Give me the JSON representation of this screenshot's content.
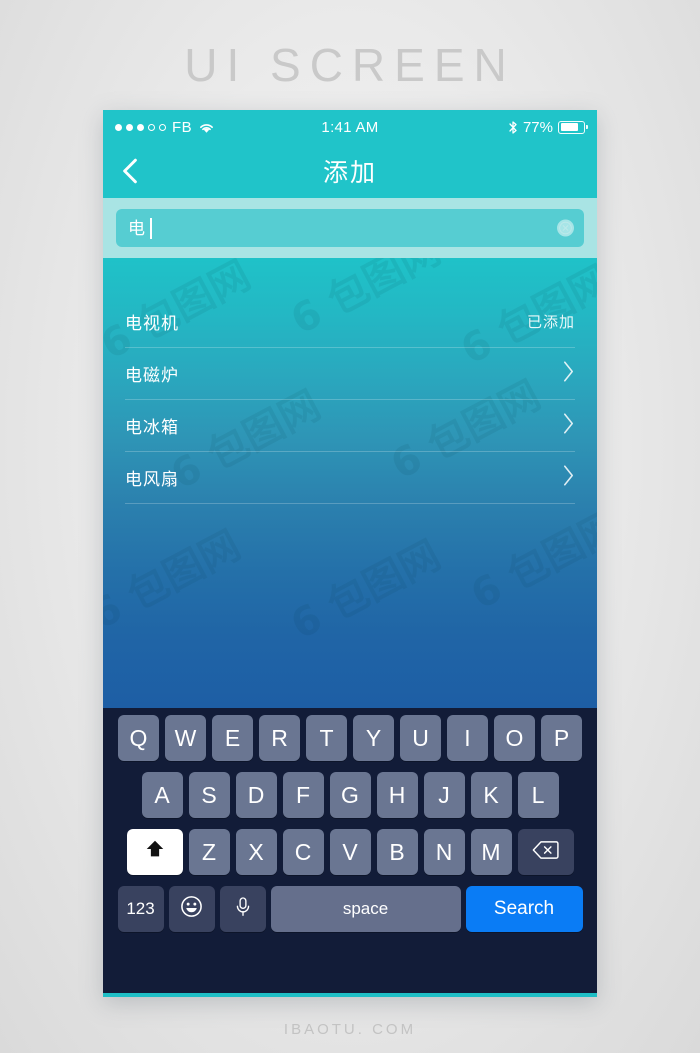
{
  "page": {
    "title": "UI SCREEN",
    "footer": "IBAOTU. COM",
    "watermark_text": "6 包图网"
  },
  "colors": {
    "accent_teal": "#20c4c9",
    "gradient_top": "#1fc2c8",
    "gradient_bottom": "#1d5ea5",
    "keyboard_bg": "#121c38",
    "key_bg": "#6a7692",
    "search_key_blue": "#0a7cf5",
    "searchbar_band": "#a9e4e4",
    "search_field": "#56cdd2"
  },
  "statusbar": {
    "signal_filled": 3,
    "signal_total": 5,
    "carrier": "FB",
    "wifi_icon": "wifi-icon",
    "time": "1:41 AM",
    "bluetooth_icon": "bluetooth-icon",
    "battery_percent": "77%",
    "battery_level": 77
  },
  "navbar": {
    "back_icon": "chevron-left-icon",
    "title": "添加"
  },
  "search": {
    "value": "电",
    "placeholder": "",
    "clear_icon": "clear-circle-icon"
  },
  "list": {
    "items": [
      {
        "label": "电视机",
        "status": "已添加",
        "has_chevron": false
      },
      {
        "label": "电磁炉",
        "status": "",
        "has_chevron": true
      },
      {
        "label": "电冰箱",
        "status": "",
        "has_chevron": true
      },
      {
        "label": "电风扇",
        "status": "",
        "has_chevron": true
      }
    ]
  },
  "keyboard": {
    "row1": [
      "Q",
      "W",
      "E",
      "R",
      "T",
      "Y",
      "U",
      "I",
      "O",
      "P"
    ],
    "row2": [
      "A",
      "S",
      "D",
      "F",
      "G",
      "H",
      "J",
      "K",
      "L"
    ],
    "row3": [
      "Z",
      "X",
      "C",
      "V",
      "B",
      "N",
      "M"
    ],
    "shift_icon": "shift-arrow-icon",
    "backspace_icon": "backspace-icon",
    "numeric_label": "123",
    "emoji_icon": "emoji-smiley-icon",
    "mic_icon": "microphone-icon",
    "space_label": "space",
    "search_label": "Search"
  }
}
